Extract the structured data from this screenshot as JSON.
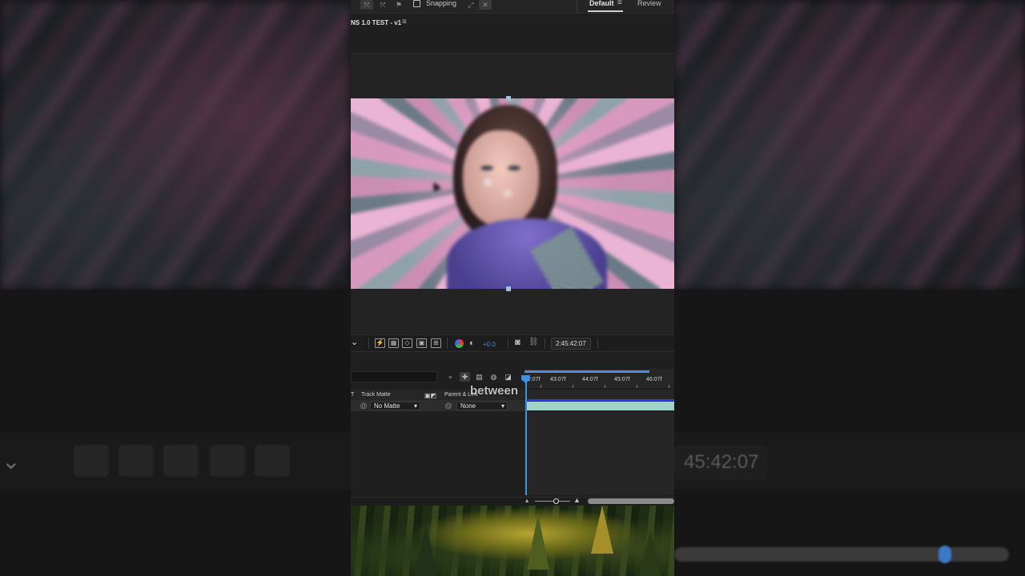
{
  "topbar": {
    "snapping_label": "Snapping",
    "workspace_default": "Default",
    "workspace_review": "Review"
  },
  "composition": {
    "tab_title": "NS 1.0 TEST - v1"
  },
  "viewer_toolbar": {
    "exposure_value": "+0.0",
    "timecode": "2:45:42:07"
  },
  "timeline": {
    "ruler_labels": [
      "42:07f",
      "43:07f",
      "44:07f",
      "45:07f",
      "46:07f"
    ],
    "headers": {
      "col_t": "T",
      "track_matte": "Track Matte",
      "parent_link": "Parent & Link"
    },
    "layer": {
      "track_matte_value": "No Matte",
      "parent_value": "None"
    },
    "caption_overlay": "between"
  },
  "background": {
    "ghost_timecode": "45:42:07"
  },
  "colors": {
    "accent_blue": "#3d8fe6",
    "layer_bar": "#9fd2c8",
    "panel_bg": "#1f1f1f"
  },
  "icons": {
    "snapping": "snapping-checkbox",
    "workspace_menu": "hamburger-icon",
    "color_channels": "rgb-channels-icon",
    "exposure": "exposure-icon",
    "camera": "camera-snapshot-icon",
    "zoom_in": "zoom-in-mountain-icon"
  }
}
